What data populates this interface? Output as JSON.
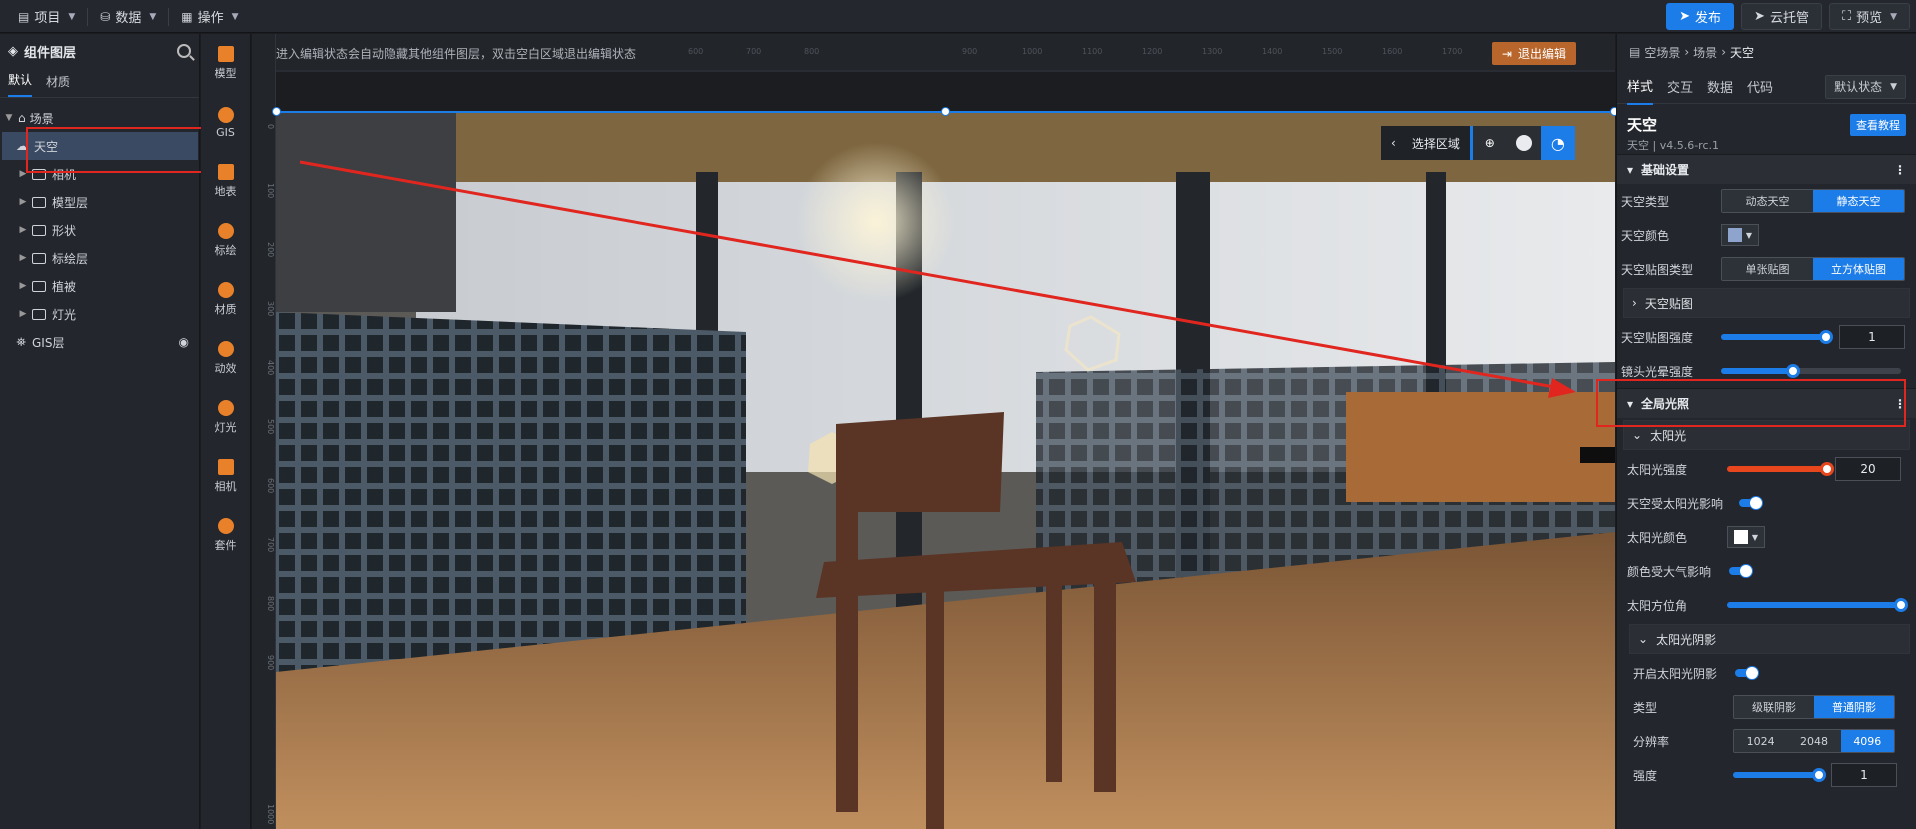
{
  "topbar": {
    "menus": [
      {
        "label": "项目",
        "icon": "file-icon"
      },
      {
        "label": "数据",
        "icon": "database-icon"
      },
      {
        "label": "操作",
        "icon": "grid-icon"
      }
    ],
    "publish": "发布",
    "cloud": "云托管",
    "preview": "预览"
  },
  "left_panel": {
    "title": "组件图层",
    "tabs": [
      "默认",
      "材质"
    ],
    "tree": [
      {
        "label": "场景",
        "level": 0,
        "expanded": true
      },
      {
        "label": "天空",
        "level": 1,
        "selected": true
      },
      {
        "label": "相机",
        "level": 1
      },
      {
        "label": "模型层",
        "level": 1
      },
      {
        "label": "形状",
        "level": 1
      },
      {
        "label": "标绘层",
        "level": 1
      },
      {
        "label": "植被",
        "level": 1
      },
      {
        "label": "灯光",
        "level": 1
      },
      {
        "label": "GIS层",
        "level": 1
      }
    ]
  },
  "icon_bar": [
    "模型",
    "GIS",
    "地表",
    "标绘",
    "材质",
    "动效",
    "灯光",
    "相机",
    "套件"
  ],
  "canvas": {
    "notice": "进入编辑状态会自动隐藏其他组件图层，双击空白区域退出编辑状态",
    "exit_edit": "退出编辑",
    "region_label": "选择区域",
    "ruler_top": [
      "600",
      "700",
      "800",
      "900",
      "1000",
      "1100",
      "1200",
      "1300",
      "1400",
      "1500",
      "1600",
      "1700"
    ],
    "ruler_left": [
      "0",
      "100",
      "200",
      "300",
      "400",
      "500",
      "600",
      "700",
      "800",
      "900",
      "1000"
    ]
  },
  "right_panel": {
    "breadcrumb": [
      "空场景",
      "场景",
      "天空"
    ],
    "tabs": [
      "样式",
      "交互",
      "数据",
      "代码"
    ],
    "state": "默认状态",
    "component_name": "天空",
    "component_version": "天空 | v4.5.6-rc.1",
    "tutorial": "查看教程",
    "basic_section": "基础设置",
    "sky_type": {
      "label": "天空类型",
      "options": [
        "动态天空",
        "静态天空"
      ],
      "selected": 1
    },
    "sky_color": {
      "label": "天空颜色",
      "color": "#8ea4cc"
    },
    "sky_texture_type": {
      "label": "天空贴图类型",
      "options": [
        "单张贴图",
        "立方体贴图"
      ],
      "selected": 1
    },
    "sky_texture": "天空贴图",
    "sky_texture_strength": {
      "label": "天空贴图强度",
      "value": "1",
      "fraction": 0.95
    },
    "lens_flare": {
      "label": "镜头光晕强度",
      "fraction": 0.4
    },
    "global_light": "全局光照",
    "sunlight": "太阳光",
    "sun_intensity": {
      "label": "太阳光强度",
      "value": "20",
      "fraction": 1.0
    },
    "sky_affected": {
      "label": "天空受太阳光影响"
    },
    "sun_color": {
      "label": "太阳光颜色",
      "color": "#ffffff"
    },
    "atmo_affected": {
      "label": "颜色受大气影响"
    },
    "sun_azimuth": {
      "label": "太阳方位角",
      "fraction": 1.0
    },
    "sun_shadow": "太阳光阴影",
    "enable_shadow": {
      "label": "开启太阳光阴影"
    },
    "shadow_type": {
      "label": "类型",
      "options": [
        "级联阴影",
        "普通阴影"
      ],
      "selected": 1
    },
    "resolution": {
      "label": "分辨率",
      "options": [
        "1024",
        "2048",
        "4096"
      ],
      "selected": 2
    },
    "shadow_strength": {
      "label": "强度",
      "value": "1",
      "fraction": 0.95
    }
  },
  "colors": {
    "accent": "#1c7ce8",
    "annotation": "#e0261f",
    "sun_slider": "#e8461c"
  }
}
